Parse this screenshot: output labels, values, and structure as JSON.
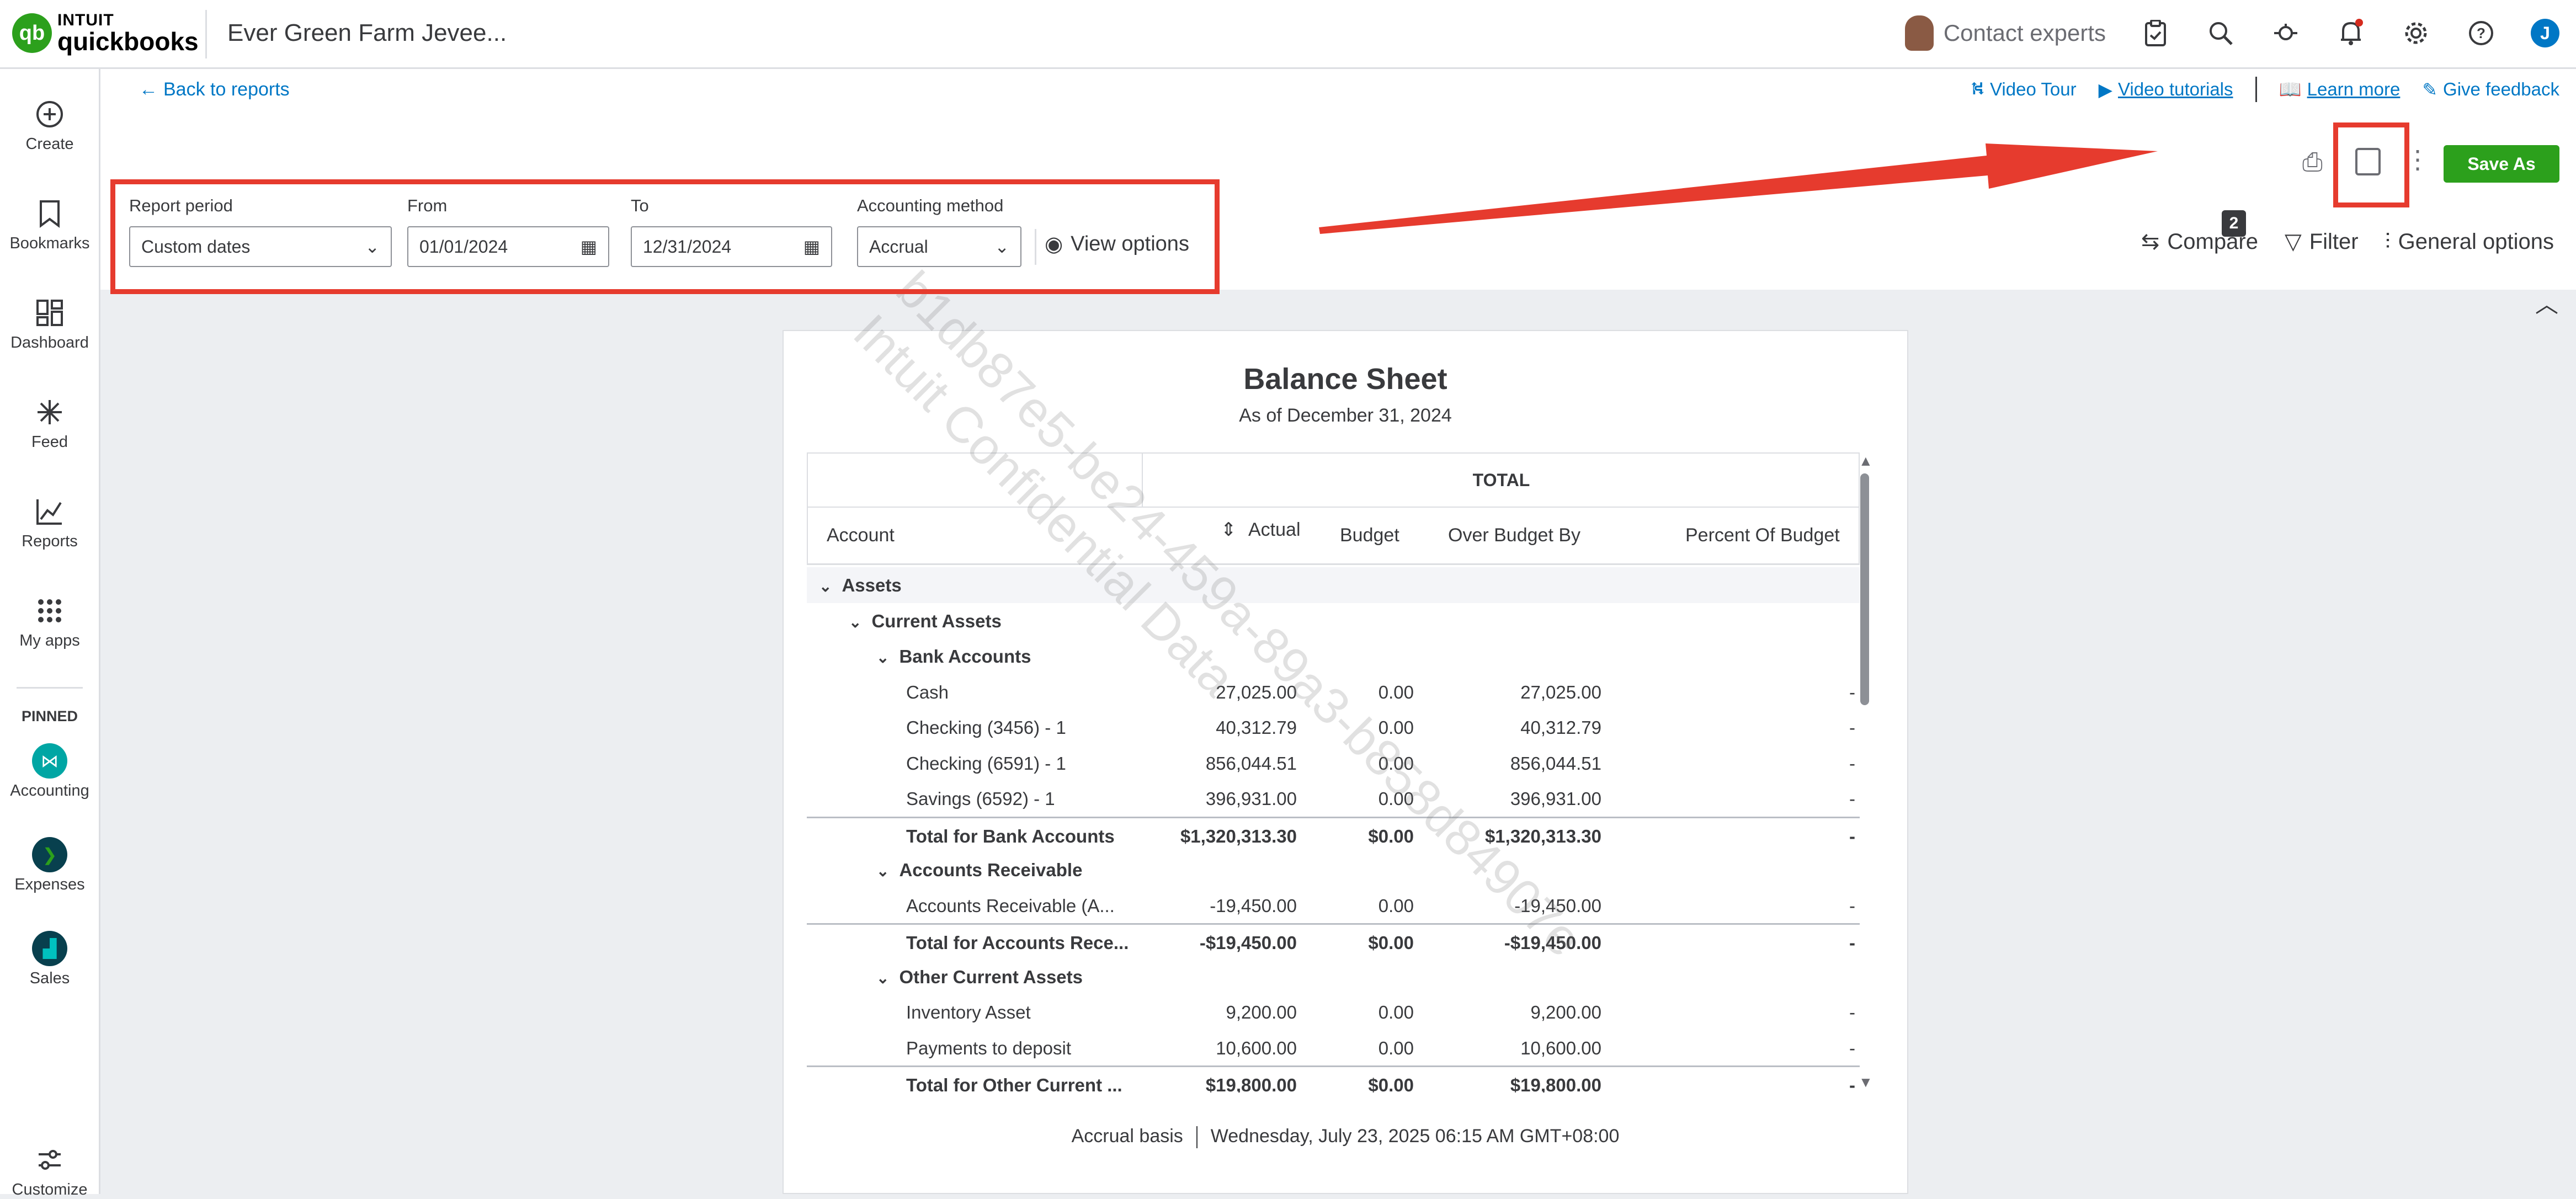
{
  "app": {
    "logo_top": "INTUIT",
    "logo_main": "quickbooks",
    "company_name": "Ever Green Farm Jevee...",
    "contact_label": "Contact experts",
    "avatar_initial": "J"
  },
  "sidebar": {
    "items": [
      {
        "label": "Create",
        "icon": "plus-circle-icon"
      },
      {
        "label": "Bookmarks",
        "icon": "bookmark-icon"
      },
      {
        "label": "Dashboard",
        "icon": "dashboard-icon"
      },
      {
        "label": "Feed",
        "icon": "feed-icon"
      },
      {
        "label": "Reports",
        "icon": "reports-icon"
      },
      {
        "label": "My apps",
        "icon": "apps-grid-icon"
      }
    ],
    "pinned_label": "PINNED",
    "pinned": [
      {
        "label": "Accounting",
        "color": "#00a6a4"
      },
      {
        "label": "Expenses",
        "color": "#00a6a4"
      },
      {
        "label": "Sales",
        "color": "#0077c5"
      }
    ],
    "bottom_label": "Customize"
  },
  "subheader": {
    "back_label": "Back to reports",
    "video_tour": "Video Tour",
    "video_tutorials": "Video tutorials",
    "learn_more": "Learn more",
    "give_feedback": "Give feedback"
  },
  "options": {
    "report_period_label": "Report period",
    "report_period_value": "Custom dates",
    "from_label": "From",
    "from_value": "01/01/2024",
    "to_label": "To",
    "to_value": "12/31/2024",
    "method_label": "Accounting method",
    "method_value": "Accrual",
    "view_options": "View options",
    "compare": "Compare",
    "compare_badge": "2",
    "filter": "Filter",
    "general_options": "General options",
    "save_as": "Save As"
  },
  "report": {
    "title": "Balance Sheet",
    "subtitle": "As of December 31, 2024",
    "total_header": "TOTAL",
    "columns": [
      "Account",
      "Actual",
      "Budget",
      "Over Budget By",
      "Percent Of Budget"
    ],
    "rows": [
      {
        "type": "section",
        "level": 0,
        "account": "Assets"
      },
      {
        "type": "section",
        "level": 1,
        "account": "Current Assets"
      },
      {
        "type": "section",
        "level": 2,
        "account": "Bank Accounts"
      },
      {
        "type": "row",
        "level": 3,
        "account": "Cash",
        "actual": "27,025.00",
        "budget": "0.00",
        "over": "27,025.00",
        "pct": "-"
      },
      {
        "type": "row",
        "level": 3,
        "account": "Checking (3456) - 1",
        "actual": "40,312.79",
        "budget": "0.00",
        "over": "40,312.79",
        "pct": "-"
      },
      {
        "type": "row",
        "level": 3,
        "account": "Checking (6591) - 1",
        "actual": "856,044.51",
        "budget": "0.00",
        "over": "856,044.51",
        "pct": "-"
      },
      {
        "type": "row",
        "level": 3,
        "account": "Savings (6592) - 1",
        "actual": "396,931.00",
        "budget": "0.00",
        "over": "396,931.00",
        "pct": "-"
      },
      {
        "type": "total",
        "level": 3,
        "account": "Total for Bank Accounts",
        "actual": "$1,320,313.30",
        "budget": "$0.00",
        "over": "$1,320,313.30",
        "pct": "-"
      },
      {
        "type": "section",
        "level": 2,
        "account": "Accounts Receivable"
      },
      {
        "type": "row",
        "level": 3,
        "account": "Accounts Receivable (A...",
        "actual": "-19,450.00",
        "budget": "0.00",
        "over": "-19,450.00",
        "pct": "-"
      },
      {
        "type": "total",
        "level": 3,
        "account": "Total for Accounts Rece...",
        "actual": "-$19,450.00",
        "budget": "$0.00",
        "over": "-$19,450.00",
        "pct": "-"
      },
      {
        "type": "section",
        "level": 2,
        "account": "Other Current Assets"
      },
      {
        "type": "row",
        "level": 3,
        "account": "Inventory Asset",
        "actual": "9,200.00",
        "budget": "0.00",
        "over": "9,200.00",
        "pct": "-"
      },
      {
        "type": "row",
        "level": 3,
        "account": "Payments to deposit",
        "actual": "10,600.00",
        "budget": "0.00",
        "over": "10,600.00",
        "pct": "-"
      },
      {
        "type": "total",
        "level": 3,
        "account": "Total for Other Current ...",
        "actual": "$19,800.00",
        "budget": "$0.00",
        "over": "$19,800.00",
        "pct": "-"
      }
    ],
    "footer_basis": "Accrual basis",
    "footer_timestamp": "Wednesday, July 23, 2025 06:15 AM GMT+08:00"
  },
  "watermark": {
    "line1": "b1db87e5-be24-459a-89a3-b858d84907e",
    "line2": "Intuit Confidential Data"
  },
  "colors": {
    "brand_green": "#2ca01c",
    "link_blue": "#0077c5",
    "annotation_red": "#e63b2e"
  }
}
